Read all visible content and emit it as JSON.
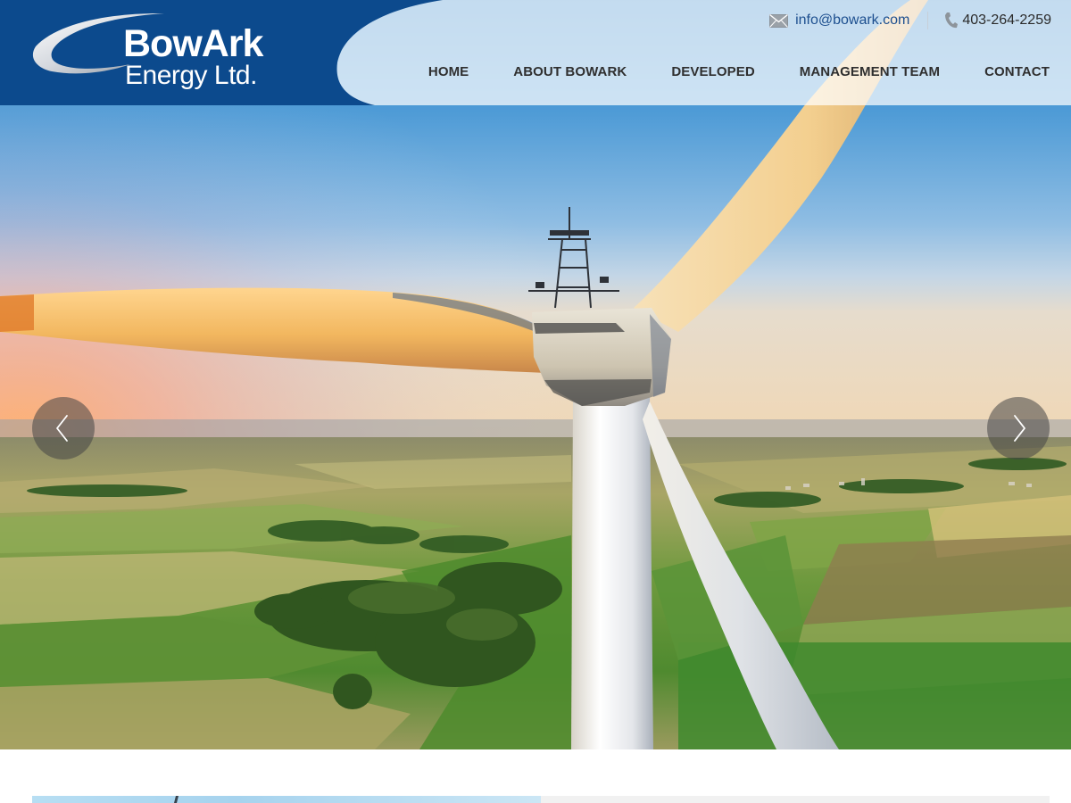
{
  "brand": {
    "name": "BowArk",
    "subtitle": "Energy Ltd.",
    "primary_color": "#0c4a8d",
    "logo_icon": "swoosh-logo-icon"
  },
  "contact": {
    "email": "info@bowark.com",
    "email_icon": "mail-icon",
    "phone": "403-264-2259",
    "phone_icon": "phone-icon"
  },
  "nav": {
    "items": [
      {
        "label": "HOME"
      },
      {
        "label": "ABOUT BOWARK"
      },
      {
        "label": "DEVELOPED"
      },
      {
        "label": "MANAGEMENT TEAM"
      },
      {
        "label": "CONTACT"
      }
    ]
  },
  "hero": {
    "image": "wind-turbine-over-farmland-at-sunset",
    "prev_icon": "chevron-left-icon",
    "next_icon": "chevron-right-icon"
  }
}
